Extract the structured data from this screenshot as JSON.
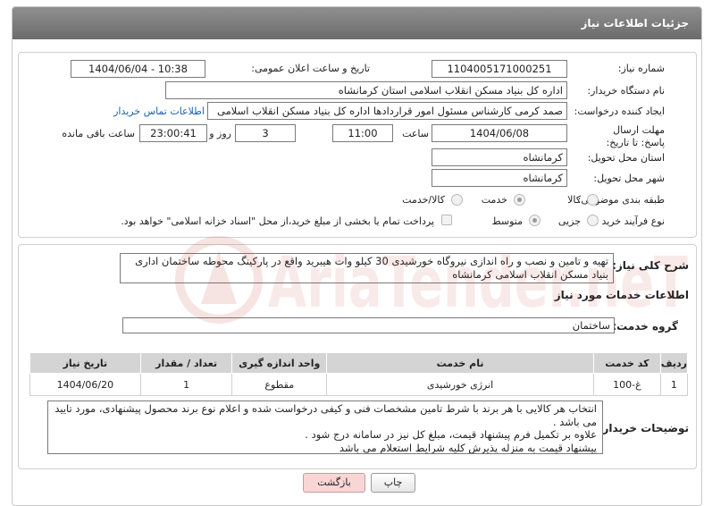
{
  "header": {
    "title": "جزئیات اطلاعات نیاز"
  },
  "fields": {
    "need_number_label": "شماره نیاز:",
    "need_number": "1104005171000251",
    "announce_label": "تاریخ و ساعت اعلان عمومی:",
    "announce_value": "1404/06/04 - 10:38",
    "buyer_org_label": "نام دستگاه خریدار:",
    "buyer_org": "اداره کل بنیاد مسکن انقلاب اسلامی استان کرمانشاه",
    "creator_label": "ایجاد کننده درخواست:",
    "creator": "صمد کرمی کارشناس مسئول امور قراردادها اداره کل بنیاد مسکن انقلاب اسلامی",
    "contact_link": "اطلاعات تماس خریدار",
    "deadline_label": "مهلت ارسال پاسخ: تا تاریخ:",
    "deadline_date": "1404/06/08",
    "time_label": "ساعت",
    "deadline_time": "11:00",
    "days_value": "3",
    "days_label": "روز و",
    "remaining_time": "23:00:41",
    "remaining_label": "ساعت باقی مانده",
    "province_label": "استان محل تحویل:",
    "province": "کرمانشاه",
    "city_label": "شهر محل تحویل:",
    "city": "کرمانشاه",
    "category_label": "طبقه بندی موضوعی:",
    "category_options": [
      "کالا",
      "خدمت",
      "کالا/خدمت"
    ],
    "process_label": "نوع فرآیند خرید :",
    "process_options": [
      "جزیی",
      "متوسط"
    ],
    "payment_note": "پرداخت تمام یا بخشی از مبلغ خرید،از محل \"اسناد خزانه اسلامی\" خواهد بود."
  },
  "description": {
    "label": "شرح کلی نیاز:",
    "text": "تهیه و تامین و نصب و راه اندازی نیروگاه خورشیدی 30 کیلو وات هیبرید واقع در پارکینگ محوطه ساختمان اداری بنیاد مسکن انقلاب اسلامی کرمانشاه"
  },
  "services": {
    "section_title": "اطلاعات خدمات مورد نیاز",
    "group_label": "گروه خدمت:",
    "group_value": "ساختمان",
    "columns": [
      "ردیف",
      "کد خدمت",
      "نام خدمت",
      "واحد اندازه گیری",
      "تعداد / مقدار",
      "تاریخ نیاز"
    ],
    "rows": [
      [
        "1",
        "غ-100",
        "انرژی خورشیدی",
        "مقطوع",
        "1",
        "1404/06/20"
      ]
    ]
  },
  "buyer_notes": {
    "label": "توضیحات خریدار:",
    "lines": [
      "انتخاب هر کالایی با هر برند با شرط تامین مشخصات فنی و کیفی درخواست شده و اعلام نوع برند محصول پیشنهادی، مورد تایید می باشد .",
      "علاوه بر تکمیل فرم پیشنهاد قیمت، مبلغ کل نیز در سامانه درج شود .",
      "پیشنهاد قیمت به منزله پذیرش کلیه شرایط استعلام می باشد"
    ]
  },
  "buttons": {
    "print": "چاپ",
    "back": "بازگشت"
  },
  "watermark": {
    "text": "AriaTender.neT"
  }
}
